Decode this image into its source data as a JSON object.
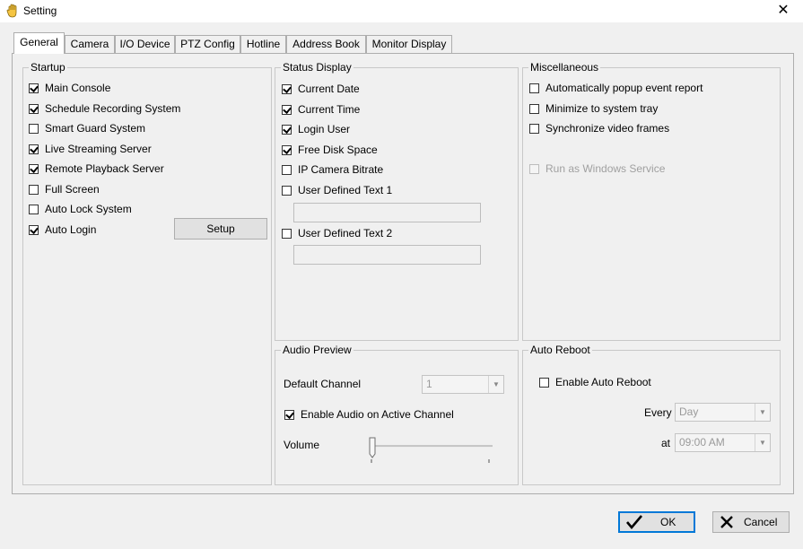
{
  "window": {
    "title": "Setting",
    "close_symbol": "✕"
  },
  "tabs": [
    {
      "label": "General",
      "active": true
    },
    {
      "label": "Camera",
      "active": false
    },
    {
      "label": "I/O Device",
      "active": false
    },
    {
      "label": "PTZ Config",
      "active": false
    },
    {
      "label": "Hotline",
      "active": false
    },
    {
      "label": "Address Book",
      "active": false
    },
    {
      "label": "Monitor Display",
      "active": false
    }
  ],
  "startup": {
    "title": "Startup",
    "items": [
      {
        "label": "Main Console",
        "checked": true
      },
      {
        "label": "Schedule Recording System",
        "checked": true
      },
      {
        "label": "Smart Guard System",
        "checked": false
      },
      {
        "label": "Live Streaming Server",
        "checked": true
      },
      {
        "label": "Remote Playback Server",
        "checked": true
      },
      {
        "label": "Full Screen",
        "checked": false
      },
      {
        "label": "Auto Lock System",
        "checked": false
      },
      {
        "label": "Auto Login",
        "checked": true
      }
    ],
    "setup_label": "Setup"
  },
  "status_display": {
    "title": "Status Display",
    "items": [
      {
        "label": "Current Date",
        "checked": true
      },
      {
        "label": "Current Time",
        "checked": true
      },
      {
        "label": "Login User",
        "checked": true
      },
      {
        "label": "Free Disk Space",
        "checked": true
      },
      {
        "label": "IP Camera Bitrate",
        "checked": false
      },
      {
        "label": "User Defined Text 1",
        "checked": false
      },
      {
        "label": "User Defined Text 2",
        "checked": false
      }
    ],
    "text1_value": "",
    "text2_value": ""
  },
  "misc": {
    "title": "Miscellaneous",
    "items": [
      {
        "label": "Automatically popup event report",
        "checked": false
      },
      {
        "label": "Minimize to system tray",
        "checked": false
      },
      {
        "label": "Synchronize video frames",
        "checked": false
      },
      {
        "label": "Run as Windows Service",
        "checked": false,
        "disabled": true
      }
    ]
  },
  "audio_preview": {
    "title": "Audio Preview",
    "default_channel_label": "Default Channel",
    "default_channel_value": "1",
    "enable_audio_label": "Enable Audio on Active Channel",
    "enable_audio_checked": true,
    "volume_label": "Volume"
  },
  "auto_reboot": {
    "title": "Auto Reboot",
    "enable_label": "Enable Auto Reboot",
    "enable_checked": false,
    "every_label": "Every",
    "every_value": "Day",
    "at_label": "at",
    "at_value": "09:00 AM"
  },
  "buttons": {
    "ok": "OK",
    "cancel": "Cancel"
  },
  "colors": {
    "focus_border": "#0078d7",
    "disabled_text": "#a0a0a0"
  }
}
